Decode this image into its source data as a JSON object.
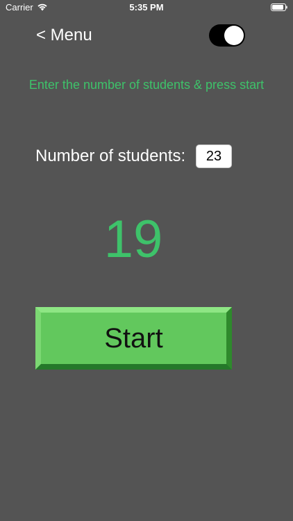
{
  "status_bar": {
    "carrier": "Carrier",
    "time": "5:35 PM",
    "wifi_icon": "wifi-icon",
    "battery_icon": "battery-icon"
  },
  "nav": {
    "back_label": "< Menu",
    "toggle_on": true
  },
  "instruction": "Enter the number of students & press start",
  "students": {
    "label": "Number of students:",
    "value": "23"
  },
  "counter": "19",
  "start_button": {
    "label": "Start"
  },
  "colors": {
    "background": "#545454",
    "accent_green": "#3ec26a",
    "button_green": "#62c85d"
  }
}
